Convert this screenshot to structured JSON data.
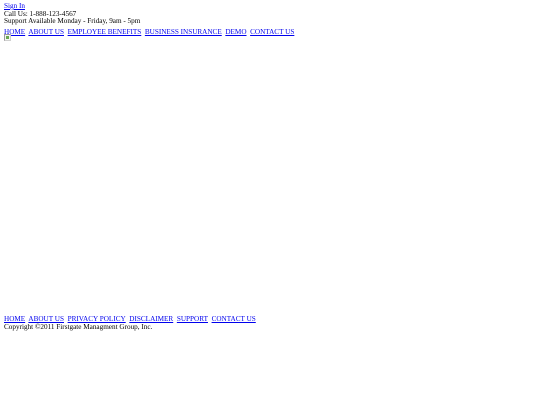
{
  "header": {
    "sign_in": "Sign In",
    "call_us": "Call Us: 1-888-123-4567",
    "support_hours": "Support Available Monday - Friday, 9am - 5pm"
  },
  "top_nav": {
    "items": [
      {
        "label": "HOME"
      },
      {
        "label": "ABOUT US"
      },
      {
        "label": "EMPLOYEE BENEFITS"
      },
      {
        "label": "BUSINESS INSURANCE"
      },
      {
        "label": "DEMO"
      },
      {
        "label": "CONTACT US"
      }
    ]
  },
  "footer_nav": {
    "items": [
      {
        "label": "HOME"
      },
      {
        "label": "ABOUT US"
      },
      {
        "label": "PRIVACY POLICY"
      },
      {
        "label": "DISCLAIMER"
      },
      {
        "label": "SUPPORT"
      },
      {
        "label": "CONTACT US"
      }
    ]
  },
  "footer": {
    "copyright": "Copyright ©2011 Firstgate Managment Group, Inc."
  },
  "colors": {
    "link": "#0000ee",
    "text": "#000000",
    "background": "#ffffff"
  }
}
